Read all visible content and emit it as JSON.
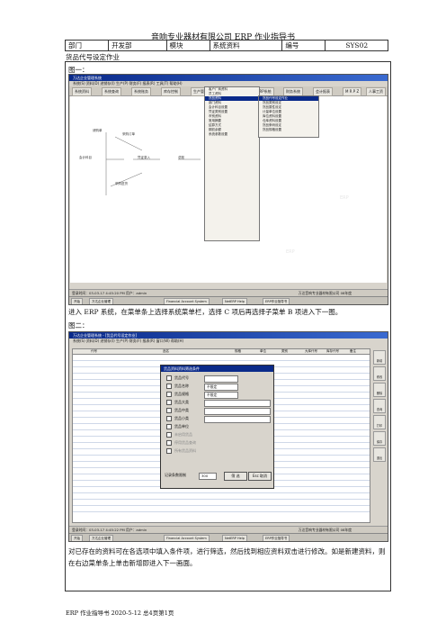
{
  "doc": {
    "title": "音响专业器材有限公司 ERP 作业指导书",
    "header": [
      "部门",
      "开发部",
      "模块",
      "系统资料",
      "编号",
      "SYS02"
    ],
    "subtitle": "货品代号设定作业",
    "fig1_label": "图一：",
    "para1": "进入 ERP 系统，在菜单条上选择系统菜单栏，选择 C 项后再选择子菜单 B 项进入下一图。",
    "fig2_label": "图二：",
    "para2": "对已存在的资料可在各选项中填入条件项，进行筛选，然后找到相应资料双击进行修改。如是新建资料，则在右边菜单条上单击新增即进入下一画面。",
    "footer": "ERP 作业指导书 2020-5-12 总4页第1页"
  },
  "fig1": {
    "window_title": "万达企业管理系统",
    "menubar": "系统(S)  资料(D)  进销存(I)  生产(P)  财务(F)  报表(R)  工具(T)  帮助(H)",
    "toolbar": [
      "系统资料",
      "系统查询",
      "系统账务",
      "库存控制",
      "生产管理",
      "MRP系统",
      "财务系统",
      "会计报表",
      "M R P Z",
      "人事工资"
    ],
    "flow_nodes": [
      "请购单",
      "采购订单",
      "采购进货",
      "进货退出",
      "应付账款",
      "会计科目",
      "凭证录入",
      "总账",
      "现金日记账",
      "报表"
    ],
    "menu_main": [
      "客户厂商资料",
      "员工资料",
      "货品资料",
      "部门资料",
      "会计科目设置",
      "凭证类别设置",
      "币别资料",
      "常用摘要",
      "结算方式",
      "期初余额",
      "系统参数设置"
    ],
    "menu_sub": [
      "货品代号设定作业",
      "货品类别设定",
      "货品属性设定",
      "计量单位设置",
      "库位资料设置",
      "仓库资料设置",
      "货品条码设定",
      "货品规格设置"
    ],
    "status": "登录时间：03-03-17 4:45:20 PM  用户：admin",
    "company": "万达音响专业器材有限公司  08年度",
    "tasks": [
      "开始",
      "万达企业管理",
      "Financial Account System",
      "NetERP Help",
      "ERP作业指导书"
    ]
  },
  "fig2": {
    "window_title": "万达企业管理系统 - [货品代号设定作业]",
    "menubar": "系统(S)  资料(D)  进销存(I)  生产(P)  财务(F)  报表(R)  窗口(W)  帮助(H)",
    "columns": [
      "代号",
      "品名",
      "规格",
      "单位",
      "类别",
      "大库代号",
      "库存代号",
      "备注"
    ],
    "side_buttons": [
      "新增",
      "修改",
      "删除",
      "查询",
      "打印",
      "保存",
      "退出"
    ],
    "dialog_title": "货品资料资料筛选条件",
    "fields": [
      "货品代号",
      "货品名称",
      "货品规格",
      "货品大类",
      "货品中类",
      "货品小类",
      "货品单位"
    ],
    "field_values": [
      "",
      "不限定",
      "不限定",
      "",
      "",
      "",
      ""
    ],
    "disabled": [
      "未启用货品",
      "停用货品查询",
      "所有货品资料"
    ],
    "count_label": "记录条数限制",
    "count_value": "300",
    "ok": "筛 选",
    "cancel": "Esc 取消",
    "status": "登录时间：03-03-17 4:45:22 PM  用户：admin",
    "company": "万达音响专业器材有限公司  08年度",
    "tasks": [
      "开始",
      "万达企业管理",
      "Financial Account System",
      "NetERP Help",
      "ERP作业指导书"
    ]
  }
}
